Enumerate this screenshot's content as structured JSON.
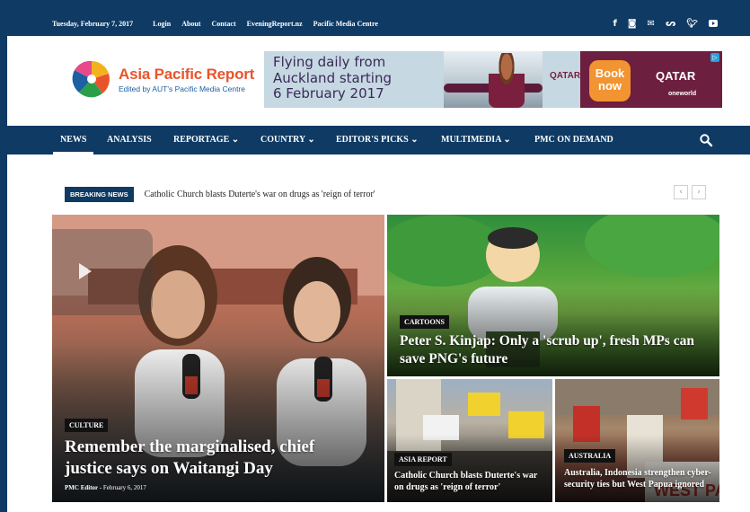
{
  "topbar": {
    "date": "Tuesday, February 7, 2017",
    "links": [
      "Login",
      "About",
      "Contact",
      "EveningReport.nz",
      "Pacific Media Centre"
    ],
    "social_icons": [
      "facebook-icon",
      "instagram-icon",
      "mail-icon",
      "rss-icon",
      "twitter-icon",
      "youtube-icon"
    ]
  },
  "logo": {
    "title": "Asia Pacific Report",
    "subtitle": "Edited by AUT's Pacific Media Centre"
  },
  "ad": {
    "line1": "Flying daily from",
    "line2": "Auckland starting",
    "line3": "6 February 2017",
    "brand": "QATAR",
    "book": "Book now",
    "oneworld": "oneworld"
  },
  "nav": {
    "items": [
      "NEWS",
      "ANALYSIS",
      "REPORTAGE",
      "COUNTRY",
      "EDITOR'S PICKS",
      "MULTIMEDIA",
      "PMC ON DEMAND"
    ],
    "active": "NEWS",
    "dropdown_suffix": "⌄"
  },
  "breaking": {
    "label": "BREAKING NEWS",
    "text": "Catholic Church blasts Duterte's war on drugs as 'reign of terror'"
  },
  "tiles": [
    {
      "category": "CULTURE",
      "headline": "Remember the marginalised, chief justice says on Waitangi Day",
      "author": "PMC Editor",
      "date": "February 6, 2017"
    },
    {
      "category": "CARTOONS",
      "headline": "Peter S. Kinjap: Only a 'scrub up', fresh MPs can save PNG's future"
    },
    {
      "category": "ASIA REPORT",
      "headline": "Catholic Church blasts Duterte's war on drugs as 'reign of terror'"
    },
    {
      "category": "AUSTRALIA",
      "headline": "Australia, Indonesia strengthen cyber-security ties but West Papua ignored"
    }
  ],
  "colors": {
    "brand": "#0e3a64",
    "logo_orange": "#e8542c",
    "logo_blue": "#1d5fa2"
  }
}
